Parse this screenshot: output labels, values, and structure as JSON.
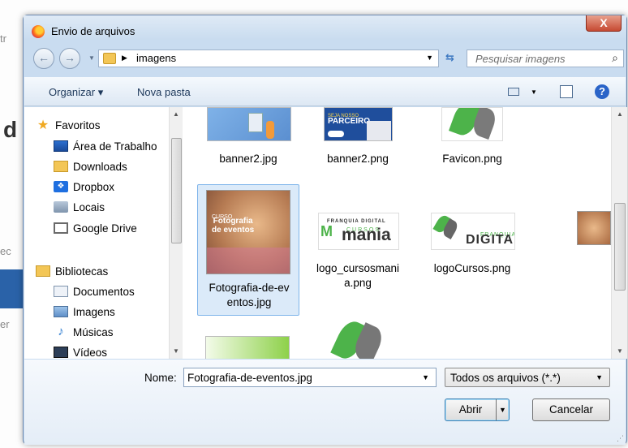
{
  "dialog": {
    "title": "Envio de arquivos",
    "close_label": "X"
  },
  "address": {
    "path": "imagens",
    "search_placeholder": "Pesquisar imagens"
  },
  "toolbar": {
    "organize": "Organizar ▾",
    "new_folder": "Nova pasta",
    "help": "?"
  },
  "nav": {
    "favorites": "Favoritos",
    "desktop": "Área de Trabalho",
    "downloads": "Downloads",
    "dropbox": "Dropbox",
    "locais": "Locais",
    "gdrive": "Google Drive",
    "libraries": "Bibliotecas",
    "documents": "Documentos",
    "images": "Imagens",
    "music": "Músicas",
    "videos": "Vídeos"
  },
  "files": [
    {
      "name": "banner2.jpg"
    },
    {
      "name": "banner2.png"
    },
    {
      "name": "Favicon.png"
    },
    {
      "name": "Fotografia-de-eventos.jpg",
      "line1": "Fotografia-de-ev",
      "line2": "entos.jpg"
    },
    {
      "name": "logo_cursosmania.png",
      "line1": "logo_cursosmani",
      "line2": "a.png"
    },
    {
      "name": "logoCursos.png"
    }
  ],
  "thumb_text": {
    "parceiro_small": "SEJA NOSSO",
    "parceiro": "PARCEIRO",
    "foto_small": "CURSO",
    "foto_title1": "Fotografia",
    "foto_title2": "de eventos",
    "franquia": "FRANQUIA DIGITAL",
    "cursos": "CURSOS",
    "mania": "mania",
    "franquia_word": "FRANQUIA",
    "digital_word": "DIGITAL"
  },
  "bottom": {
    "name_label": "Nome:",
    "file_name": "Fotografia-de-eventos.jpg",
    "filter": "Todos os arquivos (*.*)",
    "open": "Abrir",
    "cancel": "Cancelar"
  },
  "colors": {
    "selection": "#dbeaf9",
    "dialog_frame": "#c9dcf0",
    "accent_blue": "#2a64c8",
    "logo_green": "#4db34a"
  }
}
